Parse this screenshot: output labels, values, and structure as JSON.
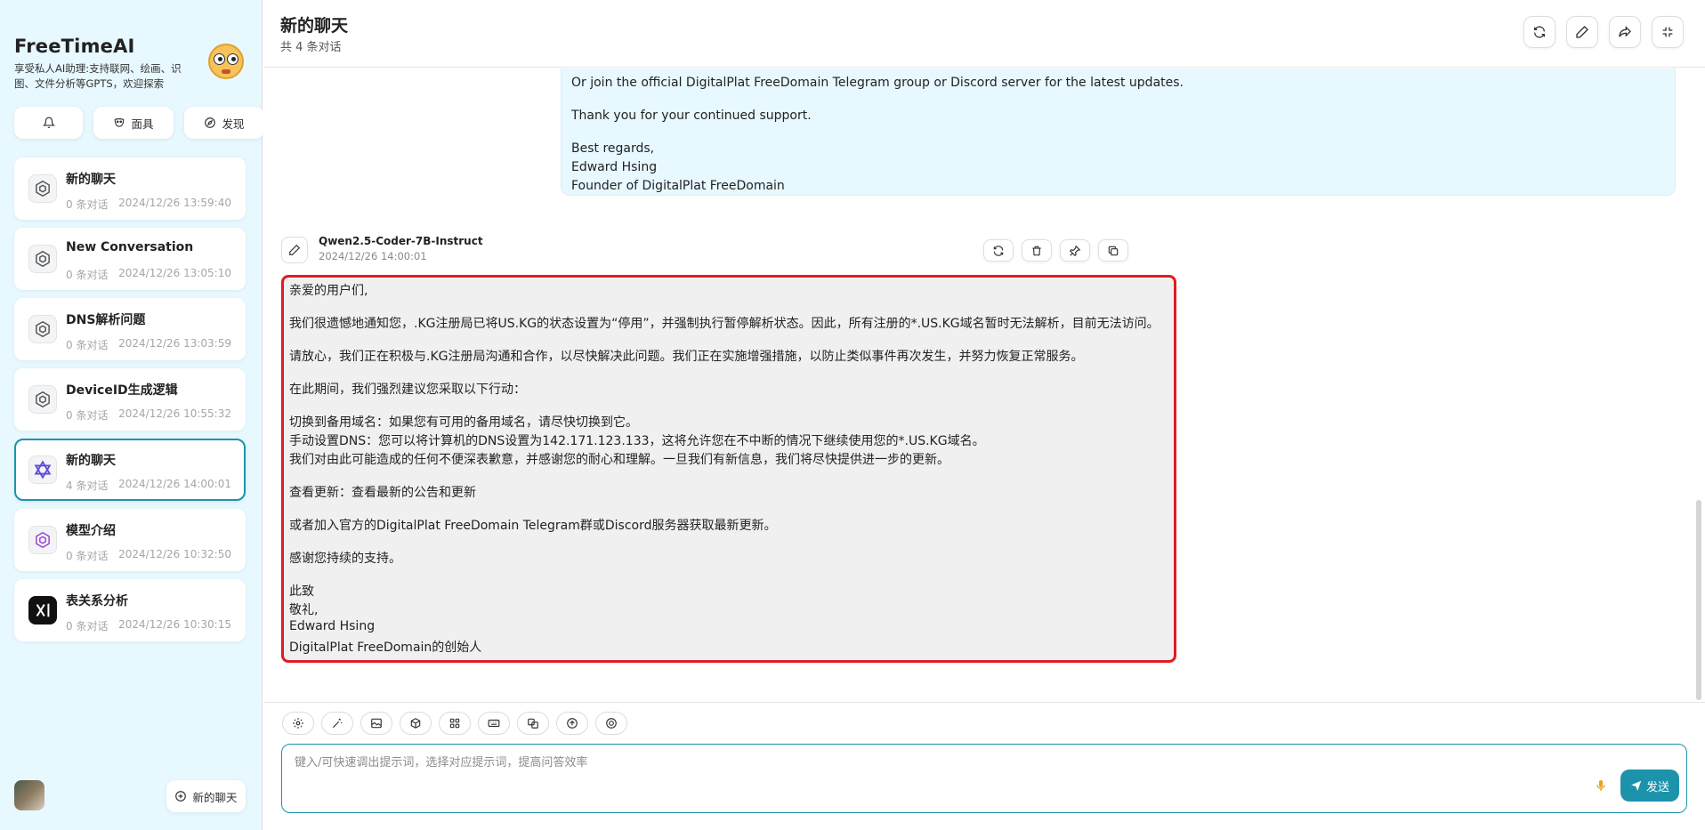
{
  "sidebar": {
    "app_name": "FreeTimeAI",
    "app_subtitle": "享受私人AI助理:支持联网、绘画、识图、文件分析等GPTS，欢迎探索",
    "mask_label": "面具",
    "discover_label": "发现",
    "new_chat_label": "新的聊天",
    "items": [
      {
        "title": "新的聊天",
        "count": "0 条对话",
        "time": "2024/12/26 13:59:40",
        "icon": "openai-icon"
      },
      {
        "title": "New Conversation",
        "count": "0 条对话",
        "time": "2024/12/26 13:05:10",
        "icon": "openai-icon"
      },
      {
        "title": "DNS解析问题",
        "count": "0 条对话",
        "time": "2024/12/26 13:03:59",
        "icon": "openai-icon"
      },
      {
        "title": "DeviceID生成逻辑",
        "count": "0 条对话",
        "time": "2024/12/26 10:55:32",
        "icon": "openai-icon"
      },
      {
        "title": "新的聊天",
        "count": "4 条对话",
        "time": "2024/12/26 14:00:01",
        "icon": "qwen-icon",
        "active": true
      },
      {
        "title": "模型介绍",
        "count": "0 条对话",
        "time": "2024/12/26 10:32:50",
        "icon": "openai-purple-icon"
      },
      {
        "title": "表关系分析",
        "count": "0 条对话",
        "time": "2024/12/26 10:30:15",
        "icon": "xai-icon"
      }
    ]
  },
  "header": {
    "title": "新的聊天",
    "subtitle": "共 4 条对话"
  },
  "user_message": {
    "lines": [
      "Or join the official DigitalPlat FreeDomain Telegram group or Discord server for the latest updates.",
      "Thank you for your continued support.",
      "Best regards,",
      "Edward Hsing",
      "Founder of DigitalPlat FreeDomain"
    ]
  },
  "bot_message": {
    "model": "Qwen2.5-Coder-7B-Instruct",
    "date": "2024/12/26 14:00:01",
    "lines": [
      "亲爱的用户们,",
      "我们很遗憾地通知您，.KG注册局已将US.KG的状态设置为“停用”，并强制执行暂停解析状态。因此，所有注册的*.US.KG域名暂时无法解析，目前无法访问。",
      "请放心，我们正在积极与.KG注册局沟通和合作，以尽快解决此问题。我们正在实施增强措施，以防止类似事件再次发生，并努力恢复正常服务。",
      "在此期间，我们强烈建议您采取以下行动：",
      "切换到备用域名：如果您有可用的备用域名，请尽快切换到它。",
      "手动设置DNS：您可以将计算机的DNS设置为142.171.123.133，这将允许您在不中断的情况下继续使用您的*.US.KG域名。",
      "我们对由此可能造成的任何不便深表歉意，并感谢您的耐心和理解。一旦我们有新信息，我们将尽快提供进一步的更新。",
      "查看更新：查看最新的公告和更新",
      "或者加入官方的DigitalPlat FreeDomain Telegram群或Discord服务器获取最新更新。",
      "感谢您持续的支持。",
      "此致",
      "敬礼,",
      "Edward Hsing",
      "DigitalPlat FreeDomain的创始人"
    ]
  },
  "input": {
    "placeholder": "键入/可快速调出提示词，选择对应提示词，提高问答效率",
    "send_label": "发送"
  },
  "colors": {
    "accent": "#1d93ab",
    "sidebar_bg": "#e7f8ff",
    "highlight_border": "#e01b24"
  }
}
